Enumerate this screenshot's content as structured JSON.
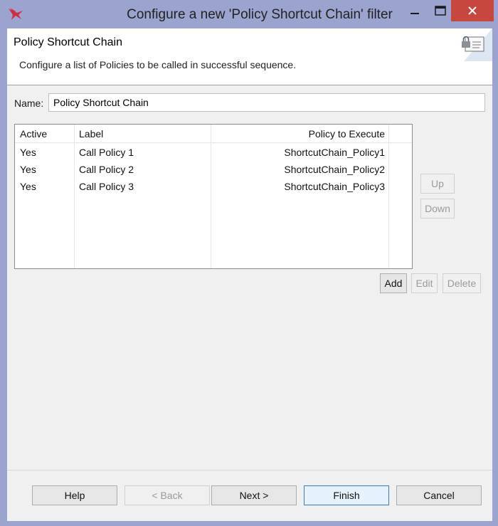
{
  "window": {
    "title": "Configure a new 'Policy Shortcut Chain' filter",
    "controls": {
      "minimize": "—",
      "maximize": "☐",
      "close": "✕"
    }
  },
  "header": {
    "title": "Policy Shortcut Chain",
    "description": "Configure a list of Policies to be called in successful sequence."
  },
  "name_field": {
    "label": "Name:",
    "value": "Policy Shortcut Chain"
  },
  "table": {
    "columns": [
      "Active",
      "Label",
      "Policy to Execute"
    ],
    "rows": [
      {
        "active": "Yes",
        "label": "Call Policy 1",
        "policy": "ShortcutChain_Policy1"
      },
      {
        "active": "Yes",
        "label": "Call Policy 2",
        "policy": "ShortcutChain_Policy2"
      },
      {
        "active": "Yes",
        "label": "Call Policy 3",
        "policy": "ShortcutChain_Policy3"
      }
    ]
  },
  "side_buttons": {
    "up": "Up",
    "down": "Down"
  },
  "row_actions": {
    "add": "Add",
    "edit": "Edit",
    "delete": "Delete"
  },
  "footer": {
    "help": "Help",
    "back": "< Back",
    "next": "Next >",
    "finish": "Finish",
    "cancel": "Cancel"
  },
  "colors": {
    "titlebar": "#9ba3cf",
    "close_button": "#c7463d",
    "app_icon": "#d22d3a",
    "default_button_border": "#3c7fb1"
  },
  "icons": [
    "app-logo-icon",
    "minimize-icon",
    "maximize-icon",
    "close-icon",
    "lock-document-icon"
  ]
}
